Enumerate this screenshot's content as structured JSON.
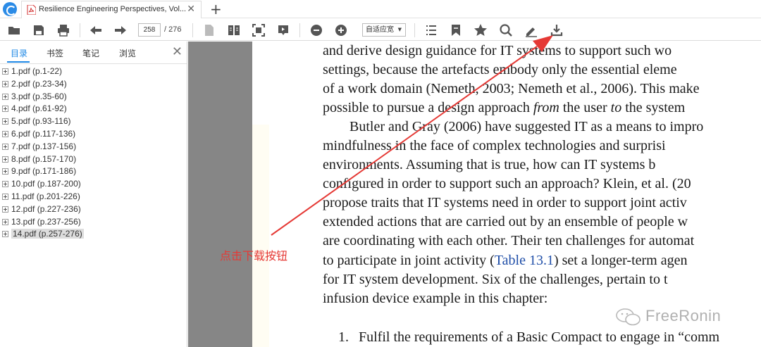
{
  "tab": {
    "title": "Resilience Engineering Perspectives, Vol..."
  },
  "toolbar": {
    "current_page": "258",
    "page_total": "/ 276",
    "zoom": "自适应宽"
  },
  "sidebar": {
    "tabs": [
      "目录",
      "书签",
      "笔记",
      "浏览"
    ],
    "items": [
      "1.pdf (p.1-22)",
      "2.pdf (p.23-34)",
      "3.pdf (p.35-60)",
      "4.pdf (p.61-92)",
      "5.pdf (p.93-116)",
      "6.pdf (p.117-136)",
      "7.pdf (p.137-156)",
      "8.pdf (p.157-170)",
      "9.pdf (p.171-186)",
      "10.pdf (p.187-200)",
      "11.pdf (p.201-226)",
      "12.pdf (p.227-236)",
      "13.pdf (p.237-256)",
      "14.pdf (p.257-276)"
    ]
  },
  "document": {
    "lines": [
      "and derive design guidance for IT systems to support such wo",
      "settings, because the artefacts embody only the essential eleme",
      "of a work domain (Nemeth, 2003; Nemeth et al., 2006). This make",
      "possible to pursue a design approach ",
      "from",
      " the user ",
      "to",
      " the system",
      "Butler and Gray (2006) have suggested IT as a means to impro",
      "mindfulness in the face of complex technologies and surprisi",
      "environments. Assuming that is true, how can IT systems b",
      "configured in order to support such an approach? Klein, et al. (20",
      "propose traits that IT systems need in order to support joint activ",
      "extended actions that are carried out by an ensemble of people w",
      "are coordinating with each other. Their ten challenges for automat",
      "to participate in joint activity (",
      "Table 13.1",
      ") set a longer-term agen",
      "for IT system development. Six of the challenges, pertain to t",
      "infusion device example in this chapter:",
      "1.",
      "Fulfil the requirements of a Basic Compact to engage in “comm"
    ]
  },
  "annotation": {
    "label": "点击下载按钮",
    "color": "#e53935"
  },
  "watermark": {
    "text": "FreeRonin"
  },
  "icons": [
    "app-logo-icon",
    "pdf-file-icon",
    "close-tab-icon",
    "new-tab-icon",
    "open-folder-icon",
    "save-icon",
    "print-icon",
    "prev-page-icon",
    "next-page-icon",
    "single-page-icon",
    "two-page-icon",
    "fit-page-icon",
    "presentation-icon",
    "zoom-out-icon",
    "zoom-in-icon",
    "outline-icon",
    "bookmark-icon",
    "star-icon",
    "search-icon",
    "annotate-pen-icon",
    "download-icon"
  ]
}
